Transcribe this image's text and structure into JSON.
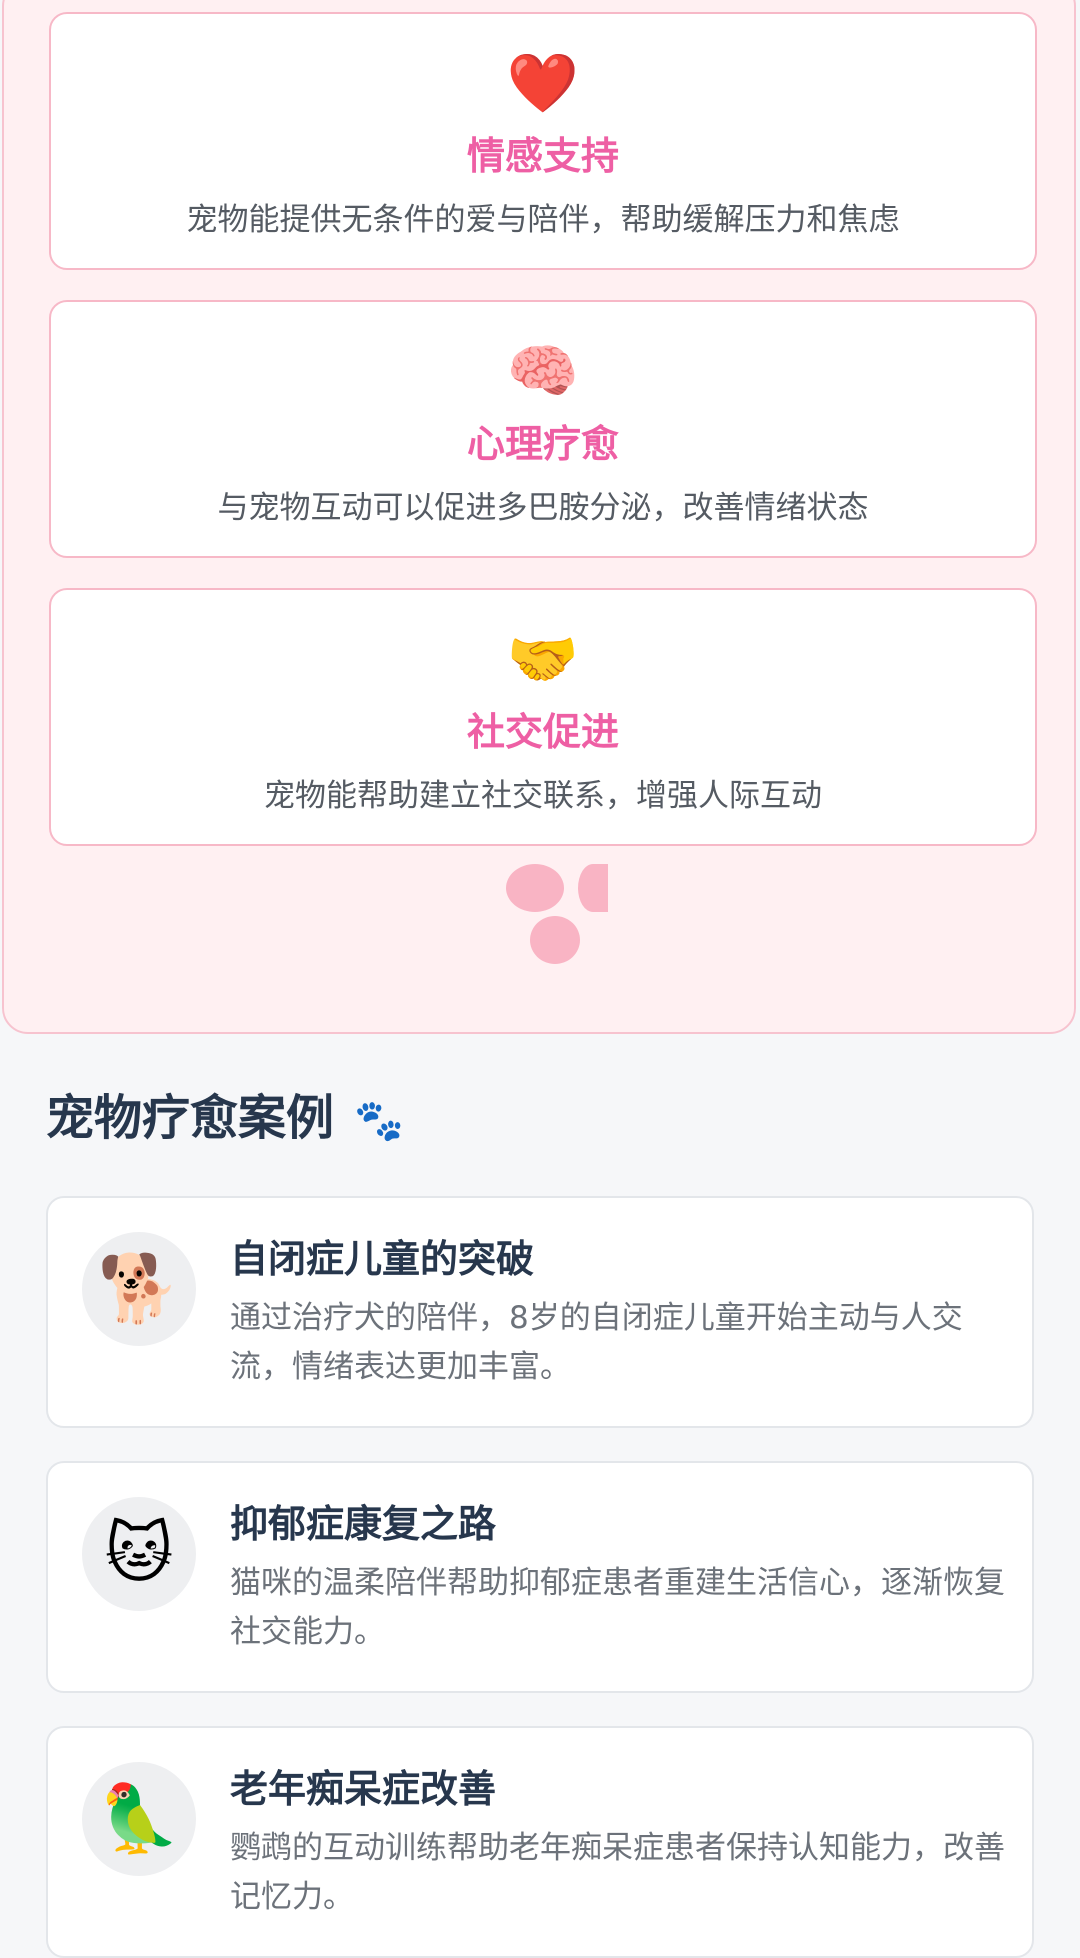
{
  "benefits": [
    {
      "icon": "❤️",
      "icon_name": "heart-icon",
      "title": "情感支持",
      "desc": "宠物能提供无条件的爱与陪伴，帮助缓解压力和焦虑"
    },
    {
      "icon": "🧠",
      "icon_name": "brain-icon",
      "title": "心理疗愈",
      "desc": "与宠物互动可以促进多巴胺分泌，改善情绪状态"
    },
    {
      "icon": "🤝",
      "icon_name": "handshake-icon",
      "title": "社交促进",
      "desc": "宠物能帮助建立社交联系，增强人际互动"
    }
  ],
  "cases_section": {
    "title": "宠物疗愈案例",
    "title_icon": "🐾",
    "items": [
      {
        "avatar": "🐕",
        "avatar_name": "dog-icon",
        "title": "自闭症儿童的突破",
        "desc": "通过治疗犬的陪伴，8岁的自闭症儿童开始主动与人交流，情绪表达更加丰富。"
      },
      {
        "avatar": "🐱",
        "avatar_name": "cat-face-icon",
        "title": "抑郁症康复之路",
        "desc": "猫咪的温柔陪伴帮助抑郁症患者重建生活信心，逐渐恢复社交能力。"
      },
      {
        "avatar": "🦜",
        "avatar_name": "parrot-icon",
        "title": "老年痴呆症改善",
        "desc": "鹦鹉的互动训练帮助老年痴呆症患者保持认知能力，改善记忆力。"
      }
    ]
  },
  "colors": {
    "accent_pink": "#ee5fa4",
    "panel_bg": "#fff0f2",
    "card_border_pink": "#f7b8c7",
    "heading_dark": "#27374d",
    "paw_blue": "#3b8ed6"
  }
}
